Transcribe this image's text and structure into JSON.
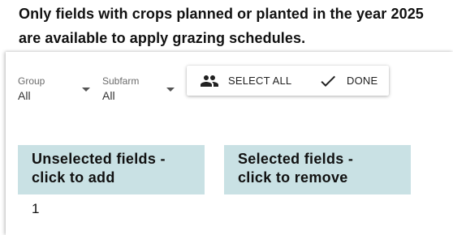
{
  "notice": {
    "line1": "Only fields with crops planned or planted in the year 2025",
    "line2": "are available to apply grazing schedules."
  },
  "filters": {
    "group": {
      "label": "Group",
      "value": "All"
    },
    "subfarm": {
      "label": "Subfarm",
      "value": "All"
    }
  },
  "actions": {
    "select_all": {
      "label": "SELECT ALL",
      "icon": "people-icon"
    },
    "done": {
      "label": "DONE",
      "icon": "check-icon"
    }
  },
  "lists": {
    "unselected": {
      "title_line1": "Unselected fields -",
      "title_line2": "click to add",
      "items": [
        "1"
      ]
    },
    "selected": {
      "title_line1": "Selected fields -",
      "title_line2": "click to remove",
      "items": []
    }
  },
  "colors": {
    "header_bg": "#c9e1e4",
    "text": "#111111",
    "muted": "#6b6b6b"
  }
}
